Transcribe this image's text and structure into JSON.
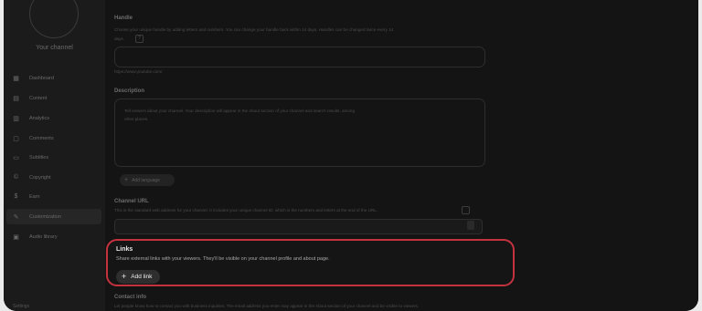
{
  "channel": {
    "name": "Your channel"
  },
  "sidebar": {
    "items": [
      {
        "label": "Dashboard",
        "icon": "dashboard-icon",
        "glyph": "▦"
      },
      {
        "label": "Content",
        "icon": "content-icon",
        "glyph": "▤"
      },
      {
        "label": "Analytics",
        "icon": "analytics-icon",
        "glyph": "▥"
      },
      {
        "label": "Comments",
        "icon": "comments-icon",
        "glyph": "▢"
      },
      {
        "label": "Subtitles",
        "icon": "subtitles-icon",
        "glyph": "▭"
      },
      {
        "label": "Copyright",
        "icon": "copyright-icon",
        "glyph": "©"
      },
      {
        "label": "Earn",
        "icon": "earn-icon",
        "glyph": "$"
      },
      {
        "label": "Customization",
        "icon": "customization-icon",
        "glyph": "✎"
      },
      {
        "label": "Audio library",
        "icon": "audio-library-icon",
        "glyph": "▣"
      }
    ]
  },
  "form": {
    "handle": {
      "label": "Handle",
      "help": "Choose your unique handle by adding letters and numbers. You can change your handle back within 14 days. Handles can be changed twice every 14",
      "help2": "days.",
      "url": "https://www.youtube.com/"
    },
    "description": {
      "label": "Description",
      "placeholder": "Tell viewers about your channel. Your description will appear in the About section of your channel and search results, among",
      "placeholder2": "other places.",
      "translation_button": "Add language"
    },
    "channel_url": {
      "label": "Channel URL",
      "help": "This is the standard web address for your channel. It includes your unique channel ID, which is the numbers and letters at the end of the URL."
    },
    "links": {
      "title": "Links",
      "description": "Share external links with your viewers. They'll be visible on your channel profile and about page.",
      "add_button": "Add link"
    },
    "contact_info": {
      "label": "Contact info",
      "help": "Let people know how to contact you with business inquiries. The email address you enter may appear in the About section of your channel and be visible to viewers."
    }
  },
  "footer": {
    "settings_label": "Settings"
  },
  "accent_color": "#c4323e"
}
